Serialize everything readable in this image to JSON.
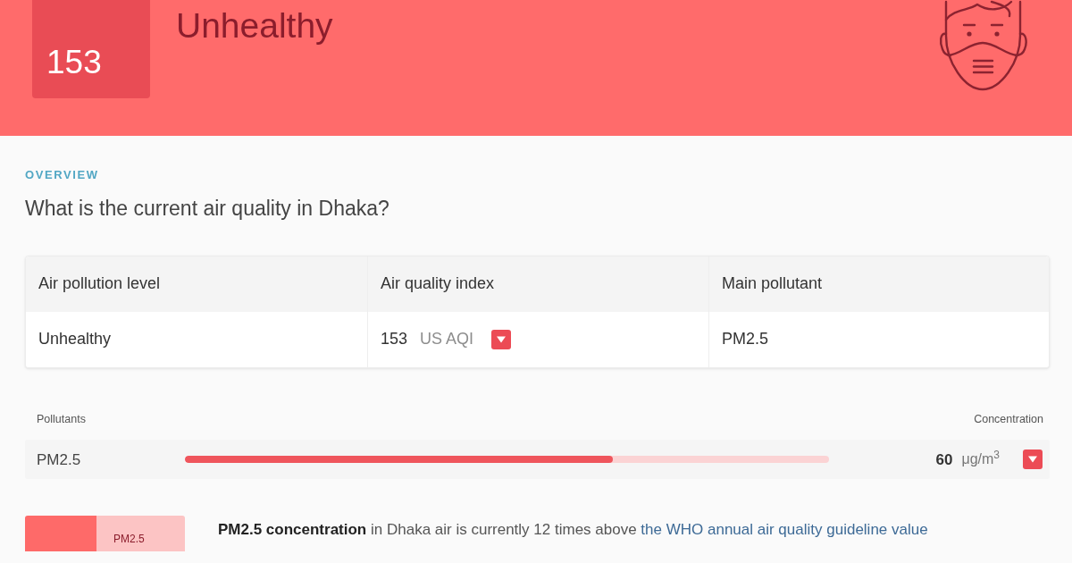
{
  "header": {
    "aqi": "153",
    "level": "Unhealthy"
  },
  "overview": {
    "eyebrow": "OVERVIEW",
    "question": "What is the current air quality in Dhaka?"
  },
  "summary_table": {
    "columns": [
      "Air pollution level",
      "Air quality index",
      "Main pollutant"
    ],
    "rows": [
      {
        "cells": [
          {
            "kind": "text",
            "text": "Unhealthy"
          },
          {
            "kind": "aqi",
            "value": "153",
            "unit": "US AQI"
          },
          {
            "kind": "text",
            "text": "PM2.5"
          }
        ]
      }
    ]
  },
  "pollutants": {
    "label": "Pollutants",
    "value_label": "Concentration",
    "rows": [
      {
        "name": "PM2.5",
        "level": 0.665,
        "value": "60",
        "unit": "μg/m$^{3}$"
      }
    ]
  },
  "comparison": {
    "tile_label": "PM2.5",
    "text": "**PM2.5 concentration** in Dhaka air is currently 12 times above",
    "link": "the WHO annual air quality guideline value"
  }
}
